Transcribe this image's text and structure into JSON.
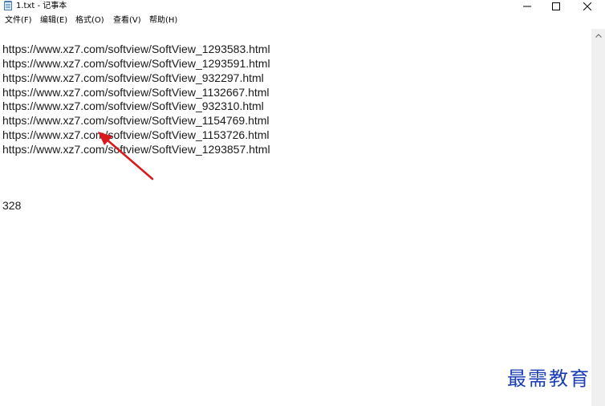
{
  "window": {
    "title": "1.txt - 记事本",
    "icon": "notepad-icon"
  },
  "controls": {
    "minimize_icon": "minimize-icon",
    "maximize_icon": "maximize-icon",
    "close_icon": "close-icon"
  },
  "menu": {
    "file": "文件(F)",
    "edit": "编辑(E)",
    "format": "格式(O)",
    "view": "查看(V)",
    "help": "帮助(H)"
  },
  "editor": {
    "lines": [
      "https://www.xz7.com/softview/SoftView_1293583.html",
      "https://www.xz7.com/softview/SoftView_1293591.html",
      "https://www.xz7.com/softview/SoftView_932297.html",
      "https://www.xz7.com/softview/SoftView_1132667.html",
      "https://www.xz7.com/softview/SoftView_932310.html",
      "https://www.xz7.com/softview/SoftView_1154769.html",
      "https://www.xz7.com/softview/SoftView_1153726.html",
      "https://www.xz7.com/softview/SoftView_1293857.html"
    ],
    "count": "328"
  },
  "annotation": {
    "arrow_color": "#d9191c"
  },
  "watermark": {
    "text": "最需教育",
    "color": "#1a3db8"
  }
}
